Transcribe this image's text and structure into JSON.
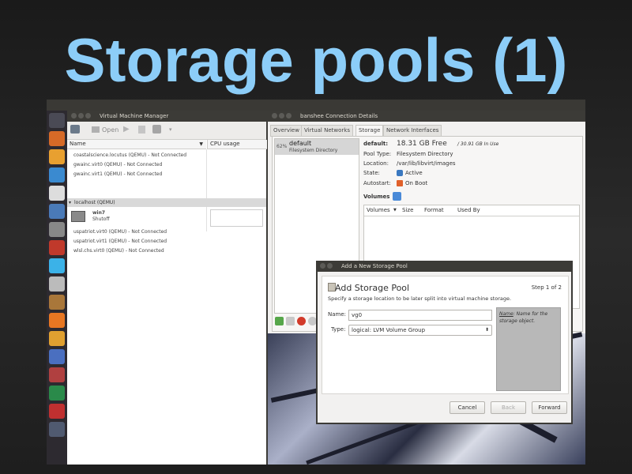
{
  "slide": {
    "title": "Storage pools (1)"
  },
  "vmm": {
    "title": "Virtual Machine Manager",
    "toolbar": {
      "open_label": "Open"
    },
    "columns": {
      "name": "Name",
      "cpu": "CPU usage"
    },
    "connections": [
      "coastalscience.locutus (QEMU) - Not Connected",
      "gwainc.virt0 (QEMU) - Not Connected",
      "gwainc.virt1 (QEMU) - Not Connected"
    ],
    "localhost": "localhost (QEMU)",
    "vm": {
      "name": "win7",
      "state": "Shutoff"
    },
    "connections_after": [
      "uspatriot.virt0 (QEMU) - Not Connected",
      "uspatriot.virt1 (QEMU) - Not Connected",
      "wlsl.chs.virt0 (QEMU) - Not Connected"
    ]
  },
  "conn": {
    "title": "banshee Connection Details",
    "tabs": [
      "Overview",
      "Virtual Networks",
      "Storage",
      "Network Interfaces"
    ],
    "pool": {
      "percent": "62%",
      "name": "default",
      "type": "Filesystem Directory"
    },
    "detail": {
      "name_label": "default:",
      "free": "18.31 GB Free",
      "in_use": " / 30.91 GB In Use",
      "pool_type_label": "Pool Type:",
      "pool_type": "Filesystem Directory",
      "location_label": "Location:",
      "location": "/var/lib/libvirt/images",
      "state_label": "State:",
      "state": "Active",
      "autostart_label": "Autostart:",
      "autostart": "On Boot",
      "volumes_label": "Volumes"
    },
    "vol_columns": [
      "Volumes",
      "Size",
      "Format",
      "Used By"
    ]
  },
  "dialog": {
    "title": "Add a New Storage Pool",
    "heading": "Add Storage Pool",
    "step": "Step 1 of 2",
    "description": "Specify a storage location to be later split into virtual machine storage.",
    "name_label": "Name:",
    "name_value": "vg0",
    "type_label": "Type:",
    "type_value": "logical: LVM Volume Group",
    "hint_key": "Name",
    "hint_text": ": Name for the storage object.",
    "cancel": "Cancel",
    "back": "Back",
    "forward": "Forward"
  },
  "colors": {
    "title": "#8ccdf8",
    "launcher": "#2d2a30",
    "titlebar": "#3c3b37"
  }
}
